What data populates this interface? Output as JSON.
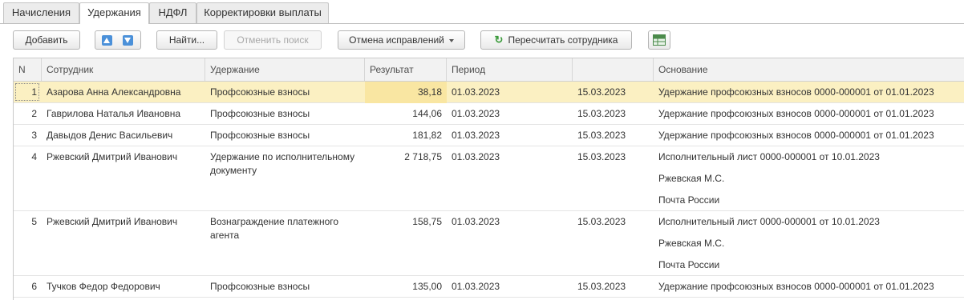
{
  "tabs": [
    "Начисления",
    "Удержания",
    "НДФЛ",
    "Корректировки выплаты"
  ],
  "active_tab_index": 1,
  "toolbar": {
    "add_label": "Добавить",
    "find_label": "Найти...",
    "cancel_search_label": "Отменить поиск",
    "corrections_label": "Отмена исправлений",
    "recalc_label": "Пересчитать сотрудника"
  },
  "table": {
    "headers": {
      "n": "N",
      "employee": "Сотрудник",
      "deduction": "Удержание",
      "result": "Результат",
      "period": "Период",
      "period_end": "",
      "basis": "Основание"
    },
    "rows": [
      {
        "n": "1",
        "employee": "Азарова Анна Александровна",
        "deduction": "Профсоюзные взносы",
        "result": "38,18",
        "period_start": "01.03.2023",
        "period_end": "15.03.2023",
        "basis": [
          "Удержание профсоюзных взносов 0000-000001 от 01.01.2023"
        ]
      },
      {
        "n": "2",
        "employee": "Гаврилова Наталья Ивановна",
        "deduction": "Профсоюзные взносы",
        "result": "144,06",
        "period_start": "01.03.2023",
        "period_end": "15.03.2023",
        "basis": [
          "Удержание профсоюзных взносов 0000-000001 от 01.01.2023"
        ]
      },
      {
        "n": "3",
        "employee": "Давыдов Денис Васильевич",
        "deduction": "Профсоюзные взносы",
        "result": "181,82",
        "period_start": "01.03.2023",
        "period_end": "15.03.2023",
        "basis": [
          "Удержание профсоюзных взносов 0000-000001 от 01.01.2023"
        ]
      },
      {
        "n": "4",
        "employee": "Ржевский Дмитрий Иванович",
        "deduction": "Удержание по исполнительному документу",
        "result": "2 718,75",
        "period_start": "01.03.2023",
        "period_end": "15.03.2023",
        "basis": [
          "Исполнительный лист 0000-000001 от 10.01.2023",
          "Ржевская М.С.",
          "Почта России"
        ]
      },
      {
        "n": "5",
        "employee": "Ржевский Дмитрий Иванович",
        "deduction": "Вознаграждение платежного агента",
        "result": "158,75",
        "period_start": "01.03.2023",
        "period_end": "15.03.2023",
        "basis": [
          "Исполнительный лист 0000-000001 от 10.01.2023",
          "Ржевская М.С.",
          "Почта России"
        ]
      },
      {
        "n": "6",
        "employee": "Тучков Федор Федорович",
        "deduction": "Профсоюзные взносы",
        "result": "135,00",
        "period_start": "01.03.2023",
        "period_end": "15.03.2023",
        "basis": [
          "Удержание профсоюзных взносов 0000-000001 от 01.01.2023"
        ]
      }
    ],
    "selected_row_index": 0
  },
  "colors": {
    "selected_row": "#fbf0c2",
    "header_bg": "#f2f2f2",
    "accent_blue": "#4a90d9",
    "refresh_green": "#3a9a3a"
  }
}
